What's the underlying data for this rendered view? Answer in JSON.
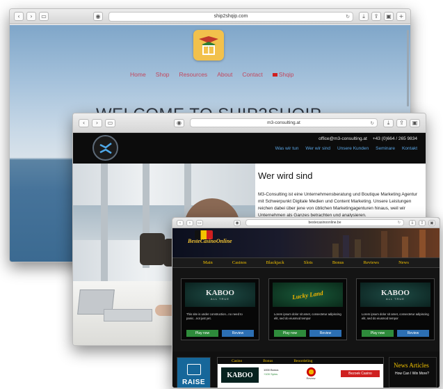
{
  "window1": {
    "url": "ship2shqip.com",
    "nav": [
      "Home",
      "Shop",
      "Resources",
      "About",
      "Contact",
      "Shqip"
    ],
    "title": "WELCOME TO SHIP2SHQIP",
    "colors": {
      "nav": "#c2475e",
      "logo_bg": "#f2c14c"
    }
  },
  "window2": {
    "url": "m3-consulting.at",
    "email": "office@m3-consulting.at",
    "phone": "+43 (0)664 / 265 9834",
    "nav": [
      "Was wir tun",
      "Wer wir sind",
      "Unsere Kunden",
      "Seminare",
      "Kontakt"
    ],
    "heading": "Wer wird sind",
    "paragraph": "M3-Consulting ist eine Unternehmensberatung und Boutique Marketing Agentur mit Schwerpunkt Digitale Medien und Content Marketing. Unsere Leistungen reichen dabei über jene von üblichen Marketingagenturen hinaus, weil wir Unternehmen als Ganzes betrachten und analysieren.",
    "colors": {
      "nav": "#5aa6e6",
      "topbar": "#0c0c0c"
    }
  },
  "window3": {
    "url": "bestecasinoonline.be",
    "brand": "BesteCasinoOnline",
    "nav": [
      "Main",
      "Casinos",
      "Blackjack",
      "Slots",
      "Bonus",
      "Reviews",
      "News"
    ],
    "cards": [
      {
        "logo": "KABOO",
        "logo_sub": "ALL TRUE",
        "text": "This site is under construction...no need to panic...not just yet.",
        "play": "Play now",
        "review": "Review"
      },
      {
        "logo": "Lucky Land",
        "logo_sub": "",
        "text": "Lorem ipsum dolor sit amet, consectetur adipiscing elit, sed do eiusmod tempor",
        "play": "Play now",
        "review": "Review"
      },
      {
        "logo": "KABOO",
        "logo_sub": "ALL TRUE",
        "text": "Lorem ipsum dolor sit amet, consectetur adipiscing elit, sed do eiusmod tempor",
        "play": "Play now",
        "review": "Review"
      }
    ],
    "raise_label": "RAISE",
    "table": {
      "headers": [
        "Casino",
        "Bonus",
        "Beoordeling"
      ],
      "casino": "KABOO",
      "bonus_line1": "1000 Bonus",
      "bonus_line2": "+100 Spins",
      "review_label": "Review",
      "visit": "Bezoek Casino"
    },
    "news_title": "News Articles",
    "news_item": "How Can I Win More?",
    "colors": {
      "nav_text": "#f3c300",
      "play": "#2e8b3b",
      "review": "#2c6fb3",
      "visit": "#cf2020"
    }
  }
}
